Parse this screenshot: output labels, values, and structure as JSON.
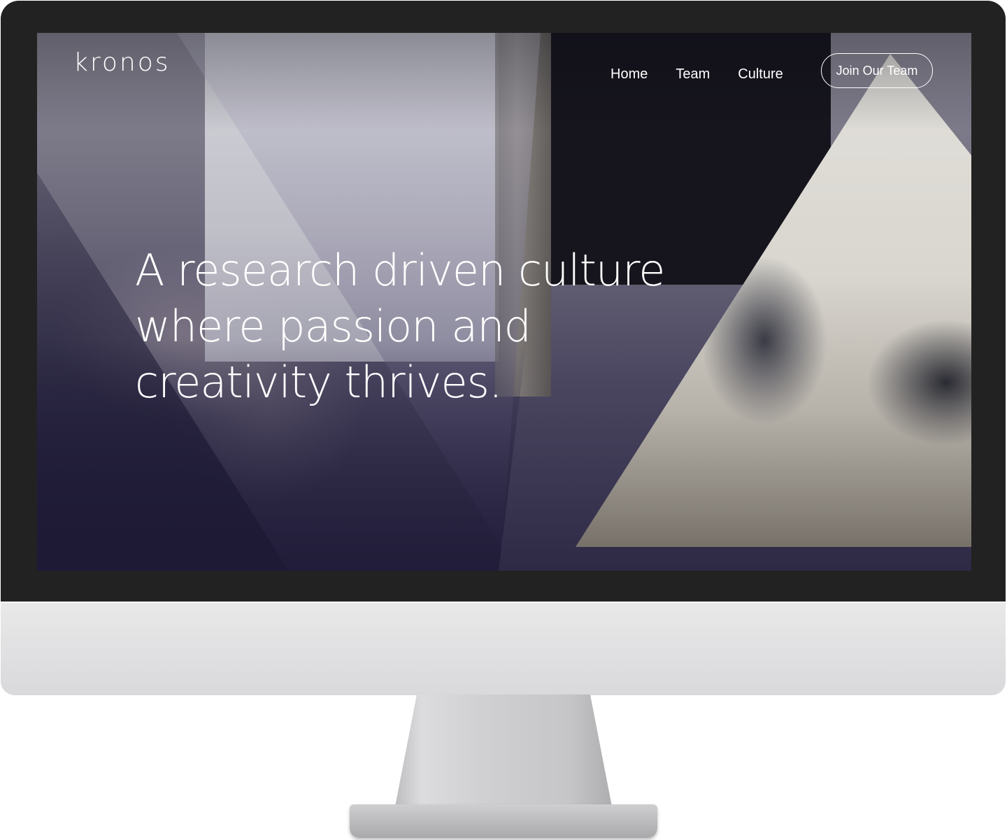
{
  "brand": {
    "logo_text": "kronos"
  },
  "nav": {
    "items": [
      {
        "label": "Home"
      },
      {
        "label": "Team"
      },
      {
        "label": "Culture"
      }
    ],
    "cta_label": "Join Our Team"
  },
  "hero": {
    "headline_lines": [
      "A research driven culture",
      "where passion and",
      "creativity thrives."
    ]
  },
  "colors": {
    "overlay_navy": "#2e2a46",
    "bezel": "#222222",
    "text": "#ffffff"
  }
}
